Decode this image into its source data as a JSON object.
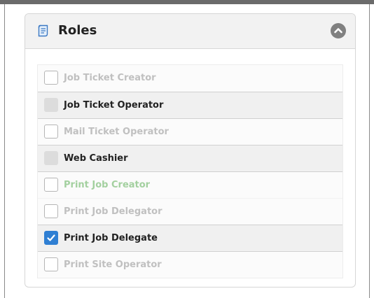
{
  "panel": {
    "title": "Roles",
    "icon": "document-icon",
    "collapse_icon": "chevron-up-icon"
  },
  "roles": [
    {
      "label": "Job Ticket Creator",
      "checked": false,
      "state": "unchecked",
      "text_color": "#c0c0c0"
    },
    {
      "label": "Job Ticket Operator",
      "checked": false,
      "state": "indeterminate",
      "text_color": "#222222"
    },
    {
      "label": "Mail Ticket Operator",
      "checked": false,
      "state": "unchecked",
      "text_color": "#c0c0c0"
    },
    {
      "label": "Web Cashier",
      "checked": false,
      "state": "indeterminate",
      "text_color": "#222222"
    },
    {
      "label": "Print Job Creator",
      "checked": false,
      "state": "unchecked",
      "text_color": "#a3d09f"
    },
    {
      "label": "Print Job Delegator",
      "checked": false,
      "state": "unchecked",
      "text_color": "#c0c0c0"
    },
    {
      "label": "Print Job Delegate",
      "checked": true,
      "state": "checked",
      "text_color": "#222222"
    },
    {
      "label": "Print Site Operator",
      "checked": false,
      "state": "unchecked",
      "text_color": "#c0c0c0"
    }
  ],
  "colors": {
    "checkbox_checked": "#2f7fd3",
    "header_bg": "#f2f2f2",
    "active_row_bg": "#f0f0f0"
  }
}
